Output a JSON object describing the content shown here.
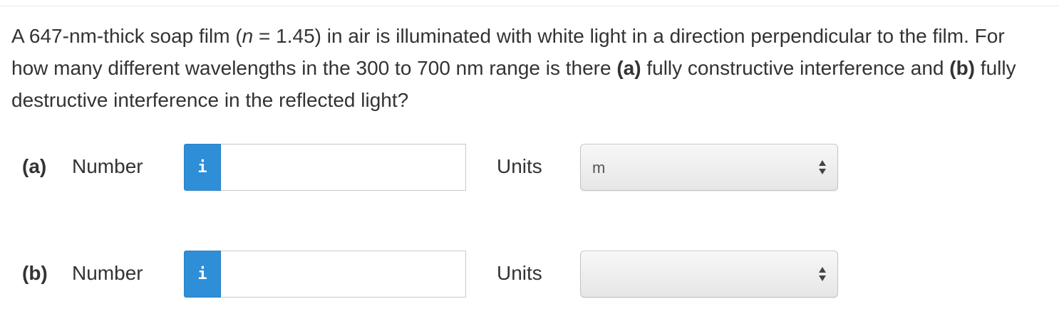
{
  "question": {
    "p1": "A 647-nm-thick soap film (",
    "n_symbol": "n",
    "p2": " = 1.45) in air is illuminated with white light in a direction perpendicular to the film. For how many different wavelengths in the 300 to 700 nm range is there ",
    "part_a_tag": "(a)",
    "p3": " fully constructive interference and ",
    "part_b_tag": "(b)",
    "p4": " fully destructive interference in the reflected light?"
  },
  "parts": [
    {
      "tag": "(a)",
      "number_label": "Number",
      "info_icon": "i",
      "number_value": "",
      "units_label": "Units",
      "units_selected": "m"
    },
    {
      "tag": "(b)",
      "number_label": "Number",
      "info_icon": "i",
      "number_value": "",
      "units_label": "Units",
      "units_selected": ""
    }
  ],
  "colors": {
    "info_button": "#2f8ed8",
    "text": "#333333"
  }
}
